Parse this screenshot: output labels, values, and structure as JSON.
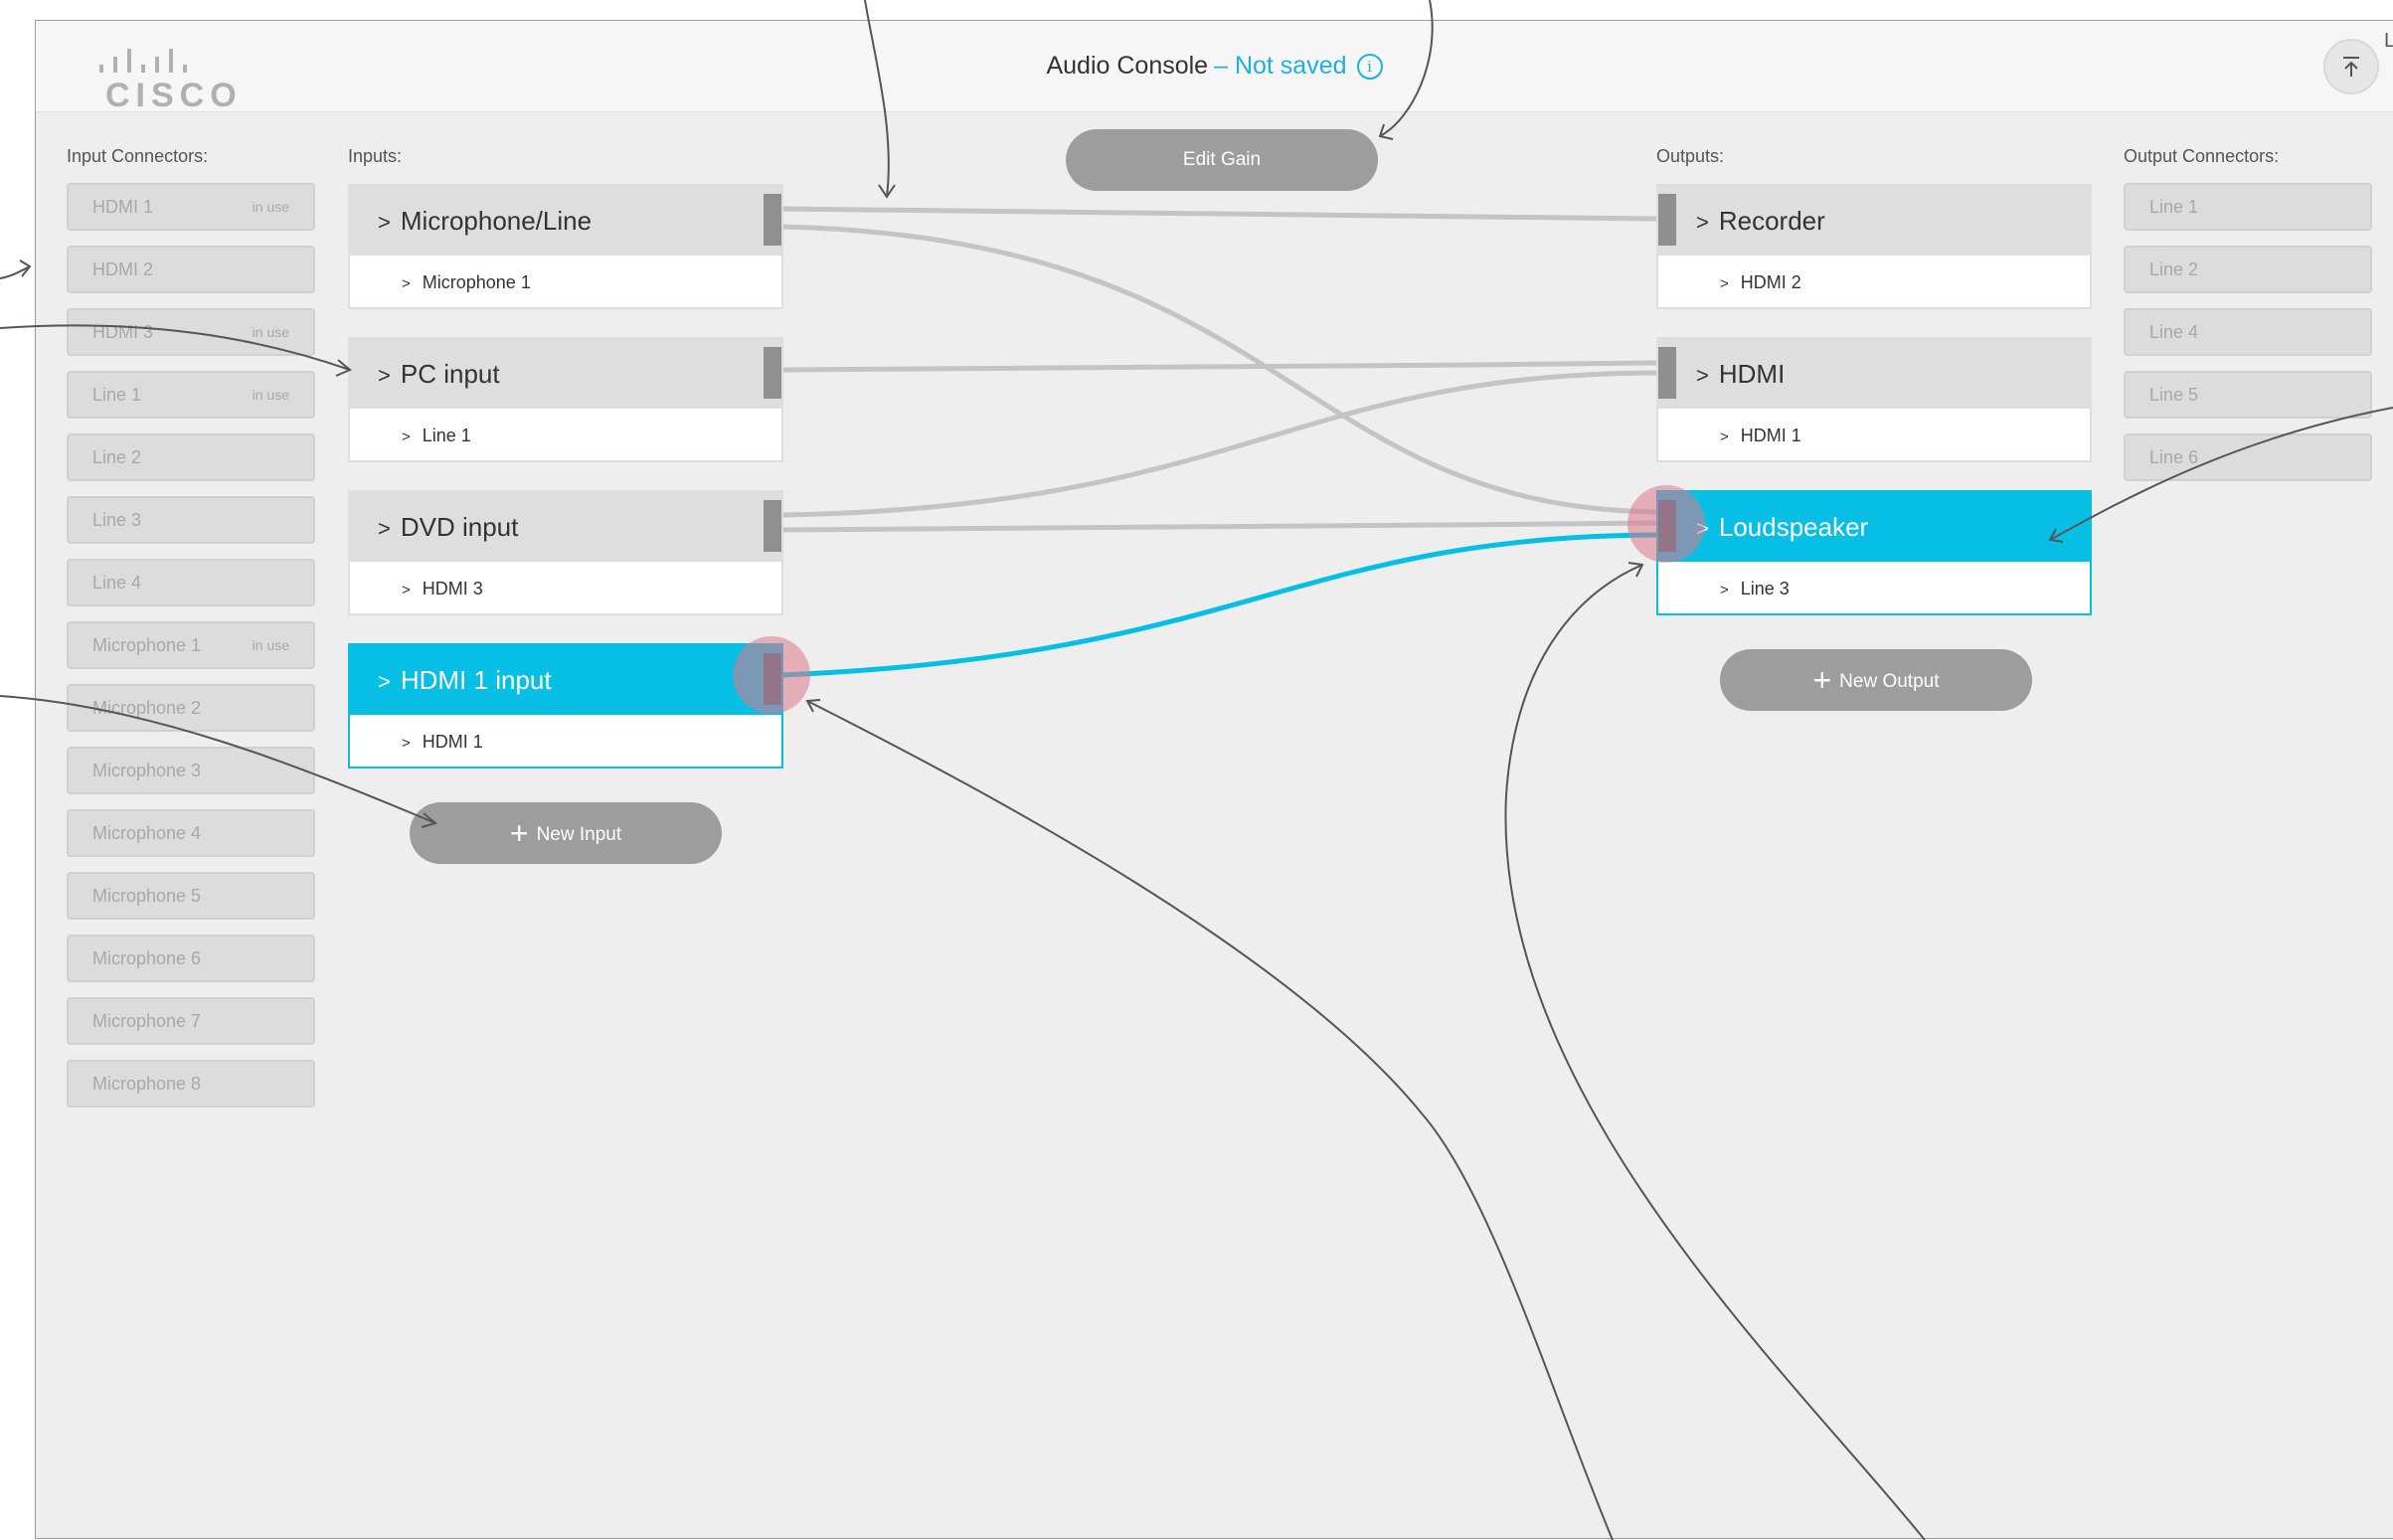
{
  "header": {
    "app_title": "Audio Console",
    "status": "– Not saved",
    "info_glyph": "i",
    "logo_text": "CISCO"
  },
  "labels": {
    "input_connectors": "Input Connectors:",
    "inputs": "Inputs:",
    "outputs": "Outputs:",
    "output_connectors": "Output Connectors:"
  },
  "buttons": {
    "edit_gain": "Edit Gain",
    "new_input": "New Input",
    "new_output": "New Output",
    "plus_glyph": "+"
  },
  "input_connectors": [
    {
      "label": "HDMI 1",
      "badge": "in use"
    },
    {
      "label": "HDMI 2",
      "badge": ""
    },
    {
      "label": "HDMI 3",
      "badge": "in use"
    },
    {
      "label": "Line 1",
      "badge": "in use"
    },
    {
      "label": "Line 2",
      "badge": ""
    },
    {
      "label": "Line 3",
      "badge": ""
    },
    {
      "label": "Line 4",
      "badge": ""
    },
    {
      "label": "Microphone 1",
      "badge": "in use"
    },
    {
      "label": "Microphone 2",
      "badge": ""
    },
    {
      "label": "Microphone 3",
      "badge": ""
    },
    {
      "label": "Microphone 4",
      "badge": ""
    },
    {
      "label": "Microphone 5",
      "badge": ""
    },
    {
      "label": "Microphone 6",
      "badge": ""
    },
    {
      "label": "Microphone 7",
      "badge": ""
    },
    {
      "label": "Microphone 8",
      "badge": ""
    }
  ],
  "inputs": [
    {
      "name": "Microphone/Line",
      "connector": "Microphone 1",
      "selected": false
    },
    {
      "name": "PC input",
      "connector": "Line 1",
      "selected": false
    },
    {
      "name": "DVD input",
      "connector": "HDMI 3",
      "selected": false
    },
    {
      "name": "HDMI 1 input",
      "connector": "HDMI 1",
      "selected": true
    }
  ],
  "outputs": [
    {
      "name": "Recorder",
      "connector": "HDMI 2",
      "selected": false
    },
    {
      "name": "HDMI",
      "connector": "HDMI 1",
      "selected": false
    },
    {
      "name": "Loudspeaker",
      "connector": "Line 3",
      "selected": true
    }
  ],
  "output_connectors": [
    {
      "label": "Line 1"
    },
    {
      "label": "Line 2"
    },
    {
      "label": "Line 4"
    },
    {
      "label": "Line 5"
    },
    {
      "label": "Line 6"
    }
  ],
  "chevron_glyph": ">",
  "corner_text": "L",
  "colors": {
    "accent": "#07bfe4",
    "status": "#20b0e0",
    "wire": "#c4c4c4",
    "handle": "#8f8f8f",
    "highlight": "#dc788c"
  },
  "icons": {
    "upload": "arrow-up-to-line-icon",
    "info": "info-circle-icon",
    "plus": "plus-icon",
    "chevron": "chevron-right-icon"
  }
}
